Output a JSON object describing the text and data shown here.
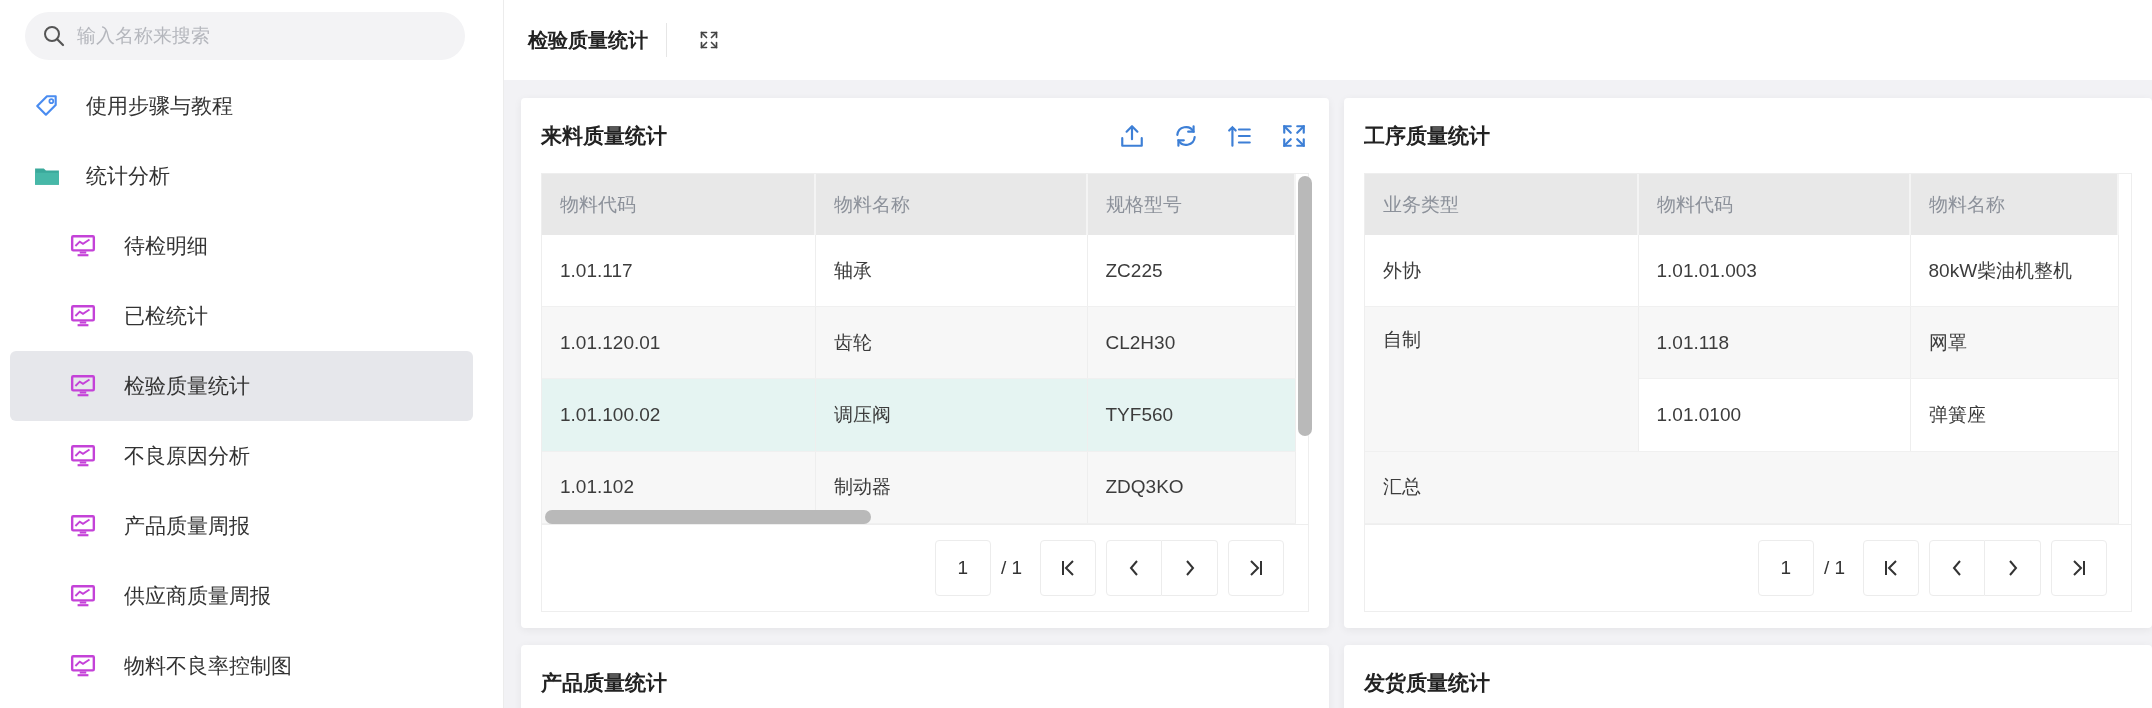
{
  "sidebar": {
    "search": {
      "placeholder": "输入名称来搜索"
    },
    "items": [
      {
        "label": "使用步骤与教程",
        "kind": "tag",
        "selected": false
      },
      {
        "label": "统计分析",
        "kind": "folder",
        "selected": false,
        "children": [
          {
            "label": "待检明细",
            "kind": "report",
            "selected": false
          },
          {
            "label": "已检统计",
            "kind": "report",
            "selected": false
          },
          {
            "label": "检验质量统计",
            "kind": "report",
            "selected": true
          },
          {
            "label": "不良原因分析",
            "kind": "report",
            "selected": false
          },
          {
            "label": "产品质量周报",
            "kind": "report",
            "selected": false
          },
          {
            "label": "供应商质量周报",
            "kind": "report",
            "selected": false
          },
          {
            "label": "物料不良率控制图",
            "kind": "report",
            "selected": false
          }
        ]
      }
    ]
  },
  "header": {
    "title": "检验质量统计"
  },
  "cards": [
    {
      "title": "来料质量统计",
      "tools": [
        {
          "kind": "upload"
        },
        {
          "kind": "refresh"
        },
        {
          "kind": "sort"
        },
        {
          "kind": "fullscreen"
        }
      ],
      "table": {
        "columns": [
          "物料代码",
          "物料名称",
          "规格型号"
        ],
        "scroll": true,
        "rows": [
          {
            "selected": false,
            "cells": [
              {
                "text": "1.01.117"
              },
              {
                "text": "轴承"
              },
              {
                "text": "ZC225"
              }
            ]
          },
          {
            "selected": false,
            "cells": [
              {
                "text": "1.01.120.01"
              },
              {
                "text": "齿轮"
              },
              {
                "text": "CL2H30"
              }
            ]
          },
          {
            "selected": true,
            "cells": [
              {
                "text": "1.01.100.02"
              },
              {
                "text": "调压阀"
              },
              {
                "text": "TYF560"
              }
            ]
          },
          {
            "selected": false,
            "cells": [
              {
                "text": "1.01.102"
              },
              {
                "text": "制动器"
              },
              {
                "text": "ZDQ3KO"
              }
            ]
          }
        ]
      },
      "pagination": {
        "page": "1",
        "total": "/ 1"
      }
    },
    {
      "title": "工序质量统计",
      "table": {
        "columns": [
          "业务类型",
          "物料代码",
          "物料名称"
        ],
        "scroll": false,
        "rows": [
          {
            "cells": [
              {
                "text": "外协"
              },
              {
                "text": "1.01.01.003"
              },
              {
                "text": "80kW柴油机整机"
              }
            ]
          },
          {
            "cells": [
              {
                "text": "自制",
                "rowspan": 2
              },
              {
                "text": "1.01.118"
              },
              {
                "text": "网罩"
              }
            ]
          },
          {
            "cells": [
              {
                "text": "1.01.0100"
              },
              {
                "text": "弹簧座"
              }
            ]
          },
          {
            "cells": [
              {
                "text": "汇总",
                "colspan": 3
              }
            ]
          }
        ]
      },
      "pagination": {
        "page": "1",
        "total": "/ 1"
      }
    },
    {
      "title": "产品质量统计"
    },
    {
      "title": "发货质量统计"
    }
  ]
}
